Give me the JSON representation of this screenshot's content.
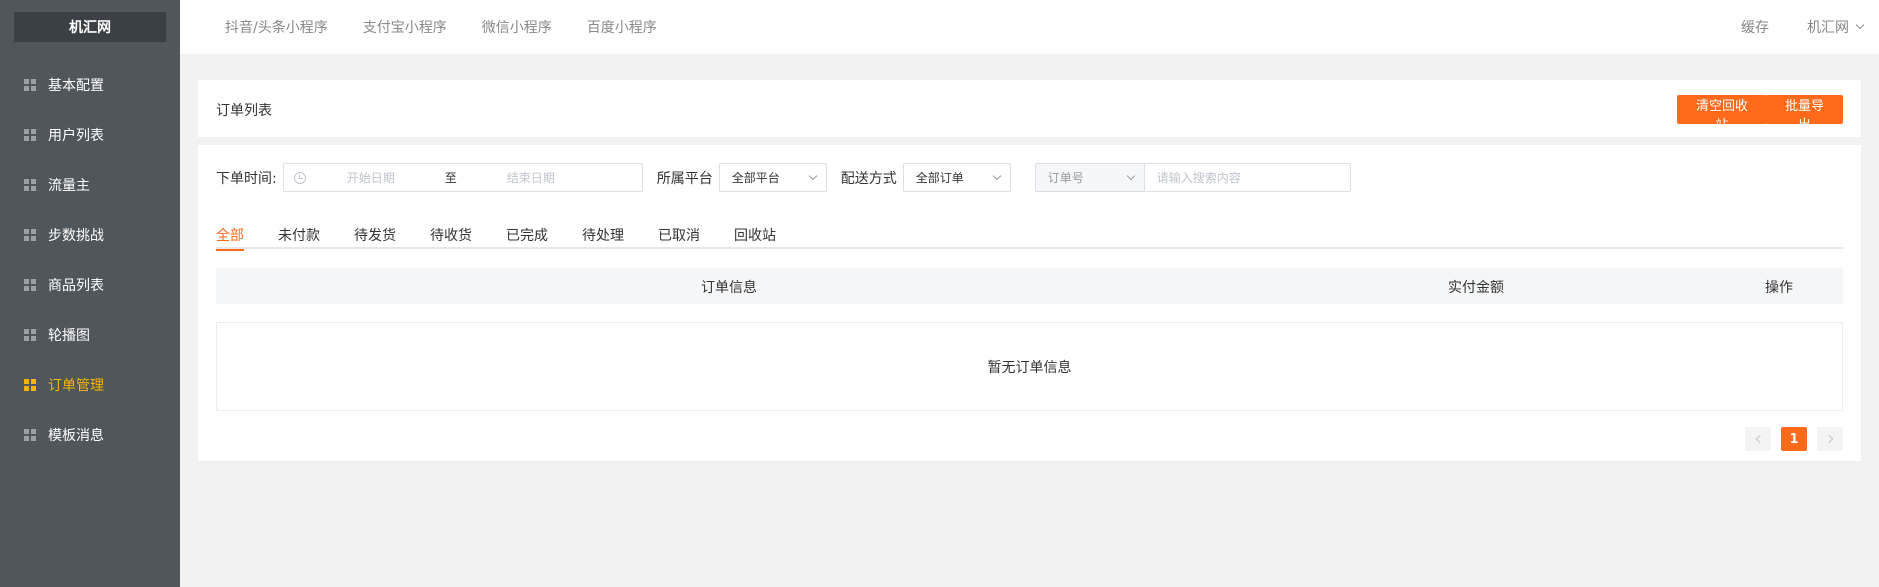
{
  "sidebar": {
    "logo": "机汇网",
    "items": [
      {
        "label": "基本配置",
        "active": false
      },
      {
        "label": "用户列表",
        "active": false
      },
      {
        "label": "流量主",
        "active": false
      },
      {
        "label": "步数挑战",
        "active": false
      },
      {
        "label": "商品列表",
        "active": false
      },
      {
        "label": "轮播图",
        "active": false
      },
      {
        "label": "订单管理",
        "active": true
      },
      {
        "label": "模板消息",
        "active": false
      }
    ]
  },
  "header": {
    "tabs": [
      "抖音/头条小程序",
      "支付宝小程序",
      "微信小程序",
      "百度小程序"
    ],
    "cache_label": "缓存",
    "user_label": "机汇网"
  },
  "panel": {
    "title": "订单列表",
    "clear_button": "清空回收站",
    "export_button": "批量导出"
  },
  "filters": {
    "time_label": "下单时间:",
    "start_placeholder": "开始日期",
    "range_separator": "至",
    "end_placeholder": "结束日期",
    "platform_label": "所属平台",
    "platform_value": "全部平台",
    "delivery_label": "配送方式",
    "delivery_value": "全部订单",
    "search_type_value": "订单号",
    "search_placeholder": "请输入搜索内容"
  },
  "order_tabs": {
    "items": [
      "全部",
      "未付款",
      "待发货",
      "待收货",
      "已完成",
      "待处理",
      "已取消",
      "回收站"
    ],
    "active_index": 0
  },
  "table": {
    "headers": [
      "订单信息",
      "实付金额",
      "操作"
    ],
    "empty_text": "暂无订单信息"
  },
  "pagination": {
    "current_page": "1"
  },
  "colors": {
    "accent": "#ff6a1a",
    "sidebar_bg": "#4f565c",
    "sidebar_active": "#f7b500"
  }
}
